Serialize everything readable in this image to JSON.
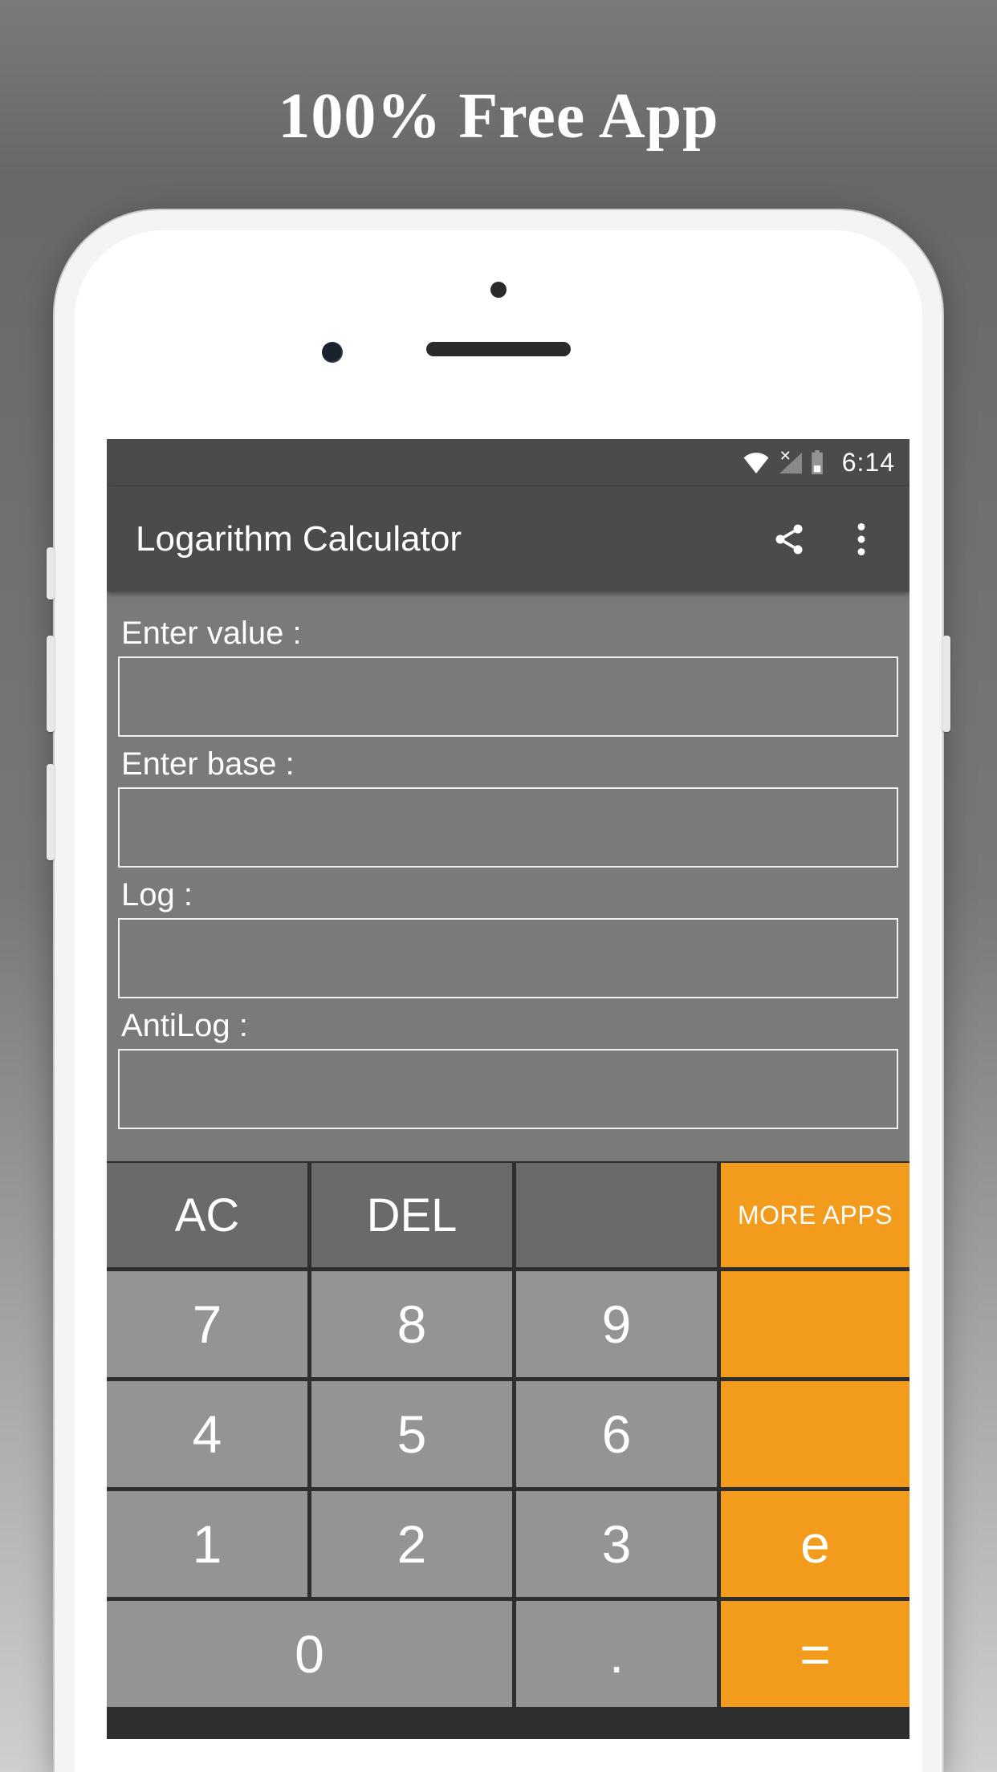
{
  "promo": {
    "headline": "100% Free App"
  },
  "statusbar": {
    "time": "6:14"
  },
  "appbar": {
    "title": "Logarithm Calculator"
  },
  "form": {
    "value_label": "Enter value :",
    "base_label": "Enter base :",
    "log_label": "Log :",
    "antilog_label": "AntiLog :",
    "value": "",
    "base": "",
    "log": "",
    "antilog": ""
  },
  "keys": {
    "ac": "AC",
    "del": "DEL",
    "more": "MORE APPS",
    "k7": "7",
    "k8": "8",
    "k9": "9",
    "k4": "4",
    "k5": "5",
    "k6": "6",
    "k1": "1",
    "k2": "2",
    "k3": "3",
    "k0": "0",
    "dot": ".",
    "e": "e",
    "eq": "="
  },
  "colors": {
    "accent": "#f29b1d"
  }
}
